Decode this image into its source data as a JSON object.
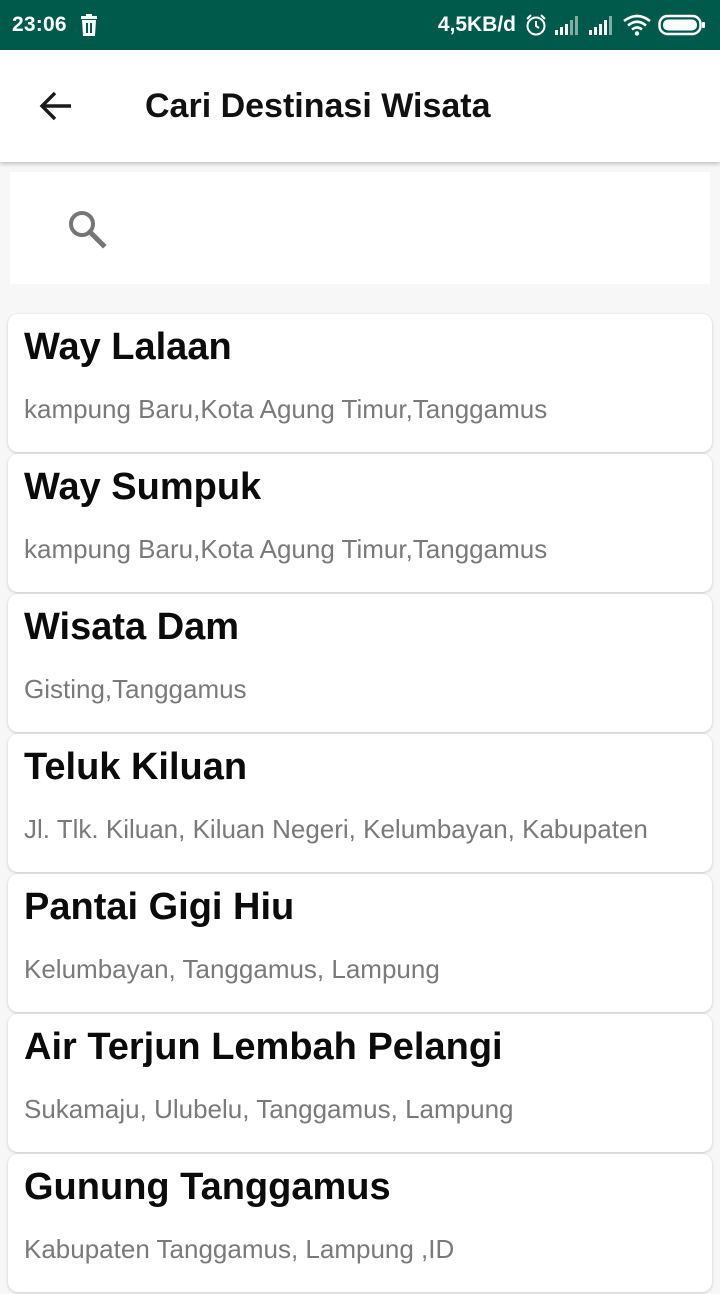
{
  "status_bar": {
    "time": "23:06",
    "net_speed": "4,5KB/d",
    "icons": [
      "trash-icon",
      "alarm-icon",
      "signal-icon",
      "signal-icon",
      "wifi-icon",
      "battery-icon"
    ]
  },
  "app_bar": {
    "title": "Cari Destinasi Wisata",
    "back_icon": "arrow-back-icon"
  },
  "search": {
    "placeholder": "",
    "value": "",
    "icon": "search-icon"
  },
  "destinations": [
    {
      "name": "Way Lalaan",
      "address": "kampung Baru,Kota Agung Timur,Tanggamus"
    },
    {
      "name": "Way Sumpuk",
      "address": "kampung Baru,Kota Agung Timur,Tanggamus"
    },
    {
      "name": "Wisata Dam",
      "address": "Gisting,Tanggamus"
    },
    {
      "name": "Teluk Kiluan",
      "address": "Jl. Tlk. Kiluan, Kiluan Negeri, Kelumbayan, Kabupaten"
    },
    {
      "name": "Pantai Gigi Hiu",
      "address": "Kelumbayan, Tanggamus, Lampung"
    },
    {
      "name": "Air Terjun Lembah Pelangi",
      "address": "Sukamaju, Ulubelu, Tanggamus, Lampung"
    },
    {
      "name": "Gunung Tanggamus",
      "address": "Kabupaten Tanggamus, Lampung ,ID"
    }
  ],
  "colors": {
    "status_bar": "#005a4c",
    "background": "#f7f7f7",
    "title_text": "#111111",
    "address_text": "#7a7a7a"
  }
}
